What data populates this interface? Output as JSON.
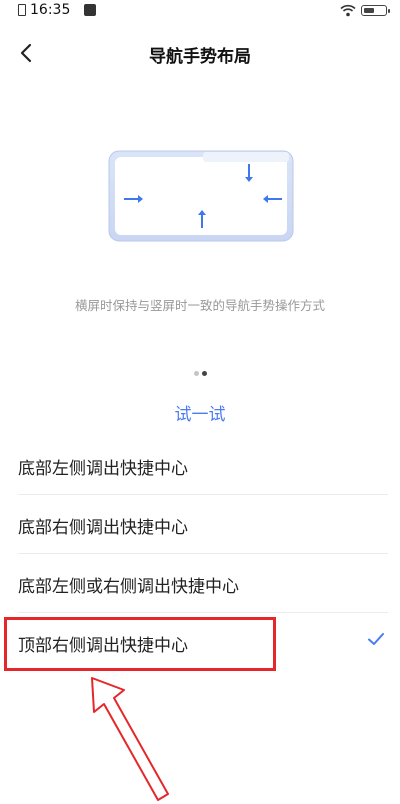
{
  "status_bar": {
    "time": "16:35"
  },
  "header": {
    "title": "导航手势布局"
  },
  "description": "横屏时保持与竖屏时一致的导航手势操作方式",
  "try_label": "试一试",
  "options": [
    {
      "label": "底部左侧调出快捷中心",
      "selected": false
    },
    {
      "label": "底部右侧调出快捷中心",
      "selected": false
    },
    {
      "label": "底部左侧或右侧调出快捷中心",
      "selected": false
    },
    {
      "label": "顶部右侧调出快捷中心",
      "selected": true
    }
  ],
  "colors": {
    "accent": "#4b7cf3",
    "highlight": "#e5262a"
  },
  "icons": {
    "back": "chevron-left-icon",
    "check": "check-icon"
  }
}
